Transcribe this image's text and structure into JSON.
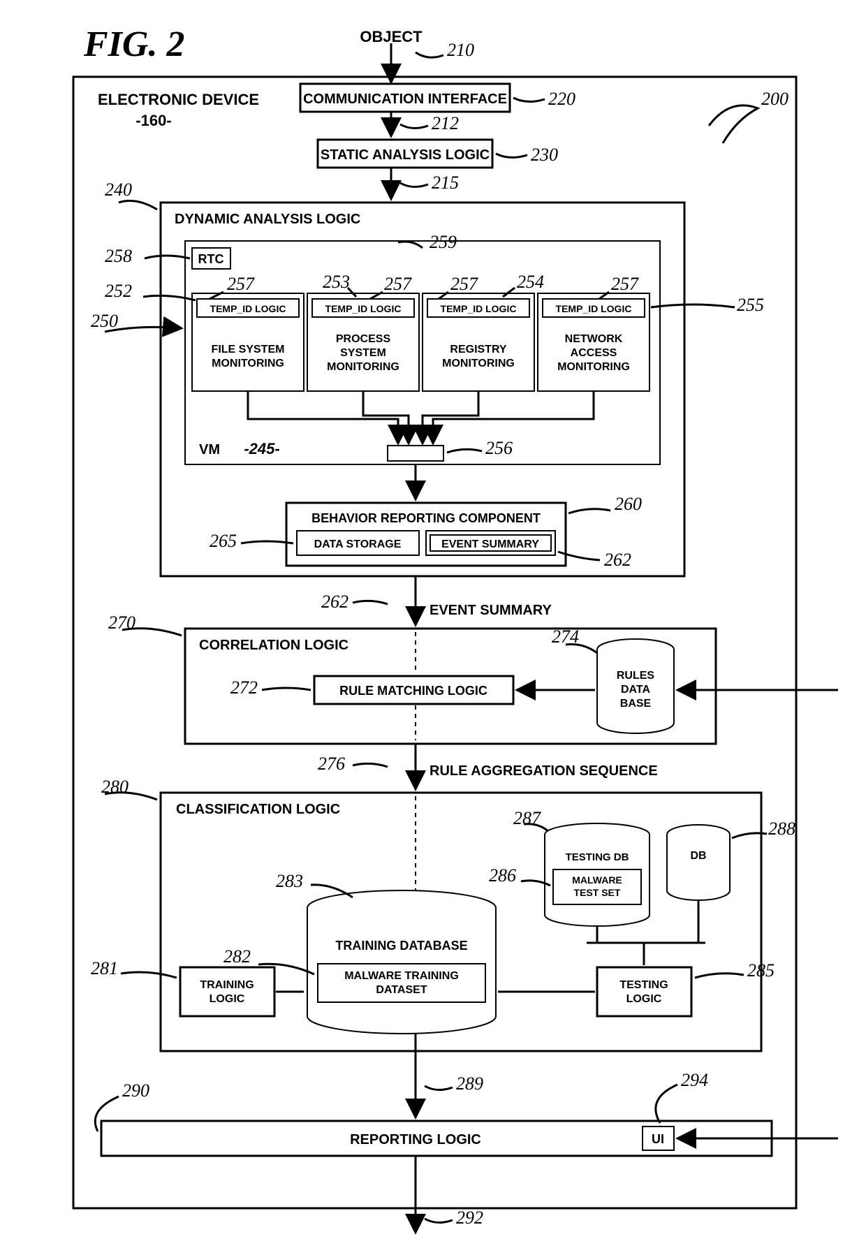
{
  "figure_label": "FIG. 2",
  "input": "OBJECT",
  "device": {
    "title": "ELECTRONIC DEVICE",
    "id": "-160-",
    "ref": "200"
  },
  "comm_interface": {
    "label": "COMMUNICATION INTERFACE",
    "ref": "220"
  },
  "static_analysis": {
    "label": "STATIC ANALYSIS LOGIC",
    "ref": "230"
  },
  "input_ref": "210",
  "arrow_212": "212",
  "arrow_215": "215",
  "dynamic": {
    "title": "DYNAMIC ANALYSIS LOGIC",
    "ref": "240",
    "vm_label": "VM",
    "vm_id": "-245-",
    "rtc": {
      "label": "RTC",
      "ref": "258"
    },
    "vm_ref_left": "250",
    "temp_id_label": "TEMP_ID LOGIC",
    "monitors": [
      {
        "name": "FILE SYSTEM MONITORING",
        "ref_side": "252",
        "ref_top": "257"
      },
      {
        "name": "PROCESS SYSTEM MONITORING",
        "ref_side": "253",
        "ref_top": "257"
      },
      {
        "name": "REGISTRY MONITORING",
        "ref_side": "254",
        "ref_top": "257"
      },
      {
        "name": "NETWORK ACCESS MONITORING",
        "ref_side": "255",
        "ref_top": "257"
      }
    ],
    "bus_ref": "256",
    "vm_inner_ref": "259",
    "behavior": {
      "label": "BEHAVIOR REPORTING COMPONENT",
      "ref": "260",
      "storage": {
        "label": "DATA STORAGE",
        "ref": "265"
      },
      "summary": {
        "label": "EVENT SUMMARY",
        "ref": "262"
      }
    }
  },
  "event_summary_out": {
    "label": "EVENT SUMMARY",
    "ref": "262"
  },
  "correlation": {
    "title": "CORRELATION LOGIC",
    "ref": "270",
    "rule_matching": {
      "label": "RULE MATCHING LOGIC",
      "ref": "272"
    },
    "rules_db": {
      "label1": "RULES",
      "label2": "DATA",
      "label3": "BASE",
      "ref": "274"
    }
  },
  "rule_agg": {
    "label": "RULE AGGREGATION SEQUENCE",
    "ref": "276"
  },
  "classification": {
    "title": "CLASSIFICATION LOGIC",
    "ref": "280",
    "training_logic": {
      "label": "TRAINING LOGIC",
      "ref": "281"
    },
    "training_db": {
      "label": "TRAINING DATABASE",
      "dataset": "MALWARE TRAINING DATASET",
      "ref_db": "283",
      "ref_ds": "282"
    },
    "testing_db": {
      "label": "TESTING DB",
      "testset": "MALWARE TEST SET",
      "ref_db": "287",
      "ref_ts": "286"
    },
    "db": {
      "label": "DB",
      "ref": "288"
    },
    "testing_logic": {
      "label": "TESTING LOGIC",
      "ref": "285"
    }
  },
  "arrow_289": "289",
  "reporting": {
    "label": "REPORTING LOGIC",
    "ref": "290",
    "ui": {
      "label": "UI",
      "ref": "294"
    }
  },
  "arrow_292": "292"
}
